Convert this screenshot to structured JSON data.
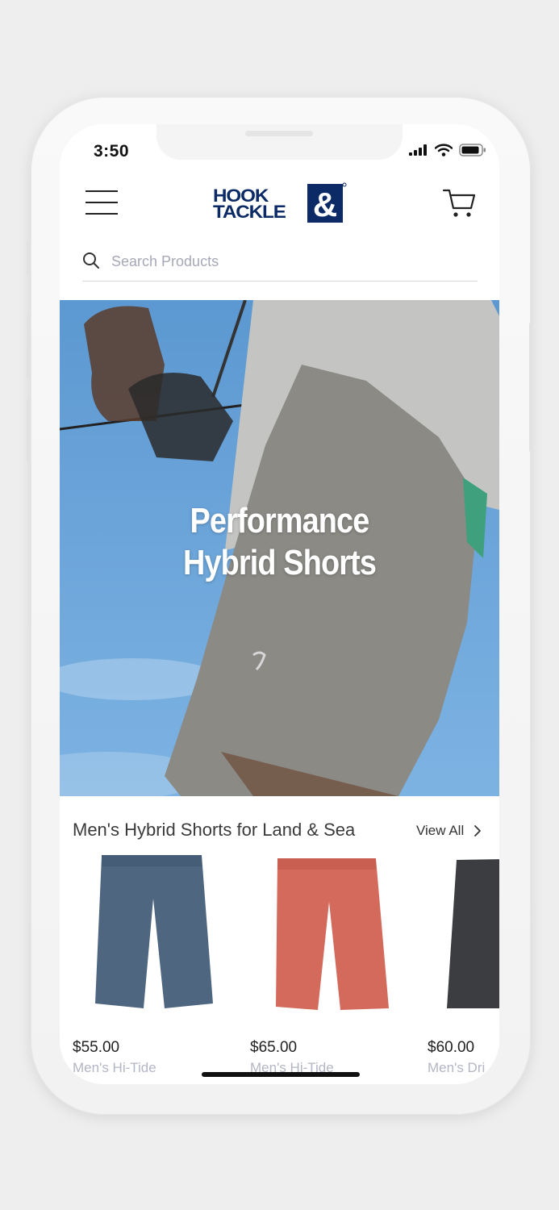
{
  "status_bar": {
    "time": "3:50"
  },
  "header": {
    "logo_line1": "HOOK",
    "logo_line2": "TACKLE",
    "logo_mark": "&"
  },
  "search": {
    "placeholder": "Search Products"
  },
  "hero": {
    "title_line1": "Performance",
    "title_line2": "Hybrid Shorts"
  },
  "section": {
    "title": "Men's Hybrid Shorts for Land & Sea",
    "view_all": "View All"
  },
  "products": [
    {
      "price": "$55.00",
      "name": "Men's Hi-Tide",
      "color": "#4e6680"
    },
    {
      "price": "$65.00",
      "name": "Men's Hi-Tide",
      "color": "#d46a5b"
    },
    {
      "price": "$60.00",
      "name": "Men's Dri",
      "color": "#3b3d40"
    }
  ],
  "colors": {
    "brand": "#0b2a66",
    "sky": "#6aa6dc"
  }
}
